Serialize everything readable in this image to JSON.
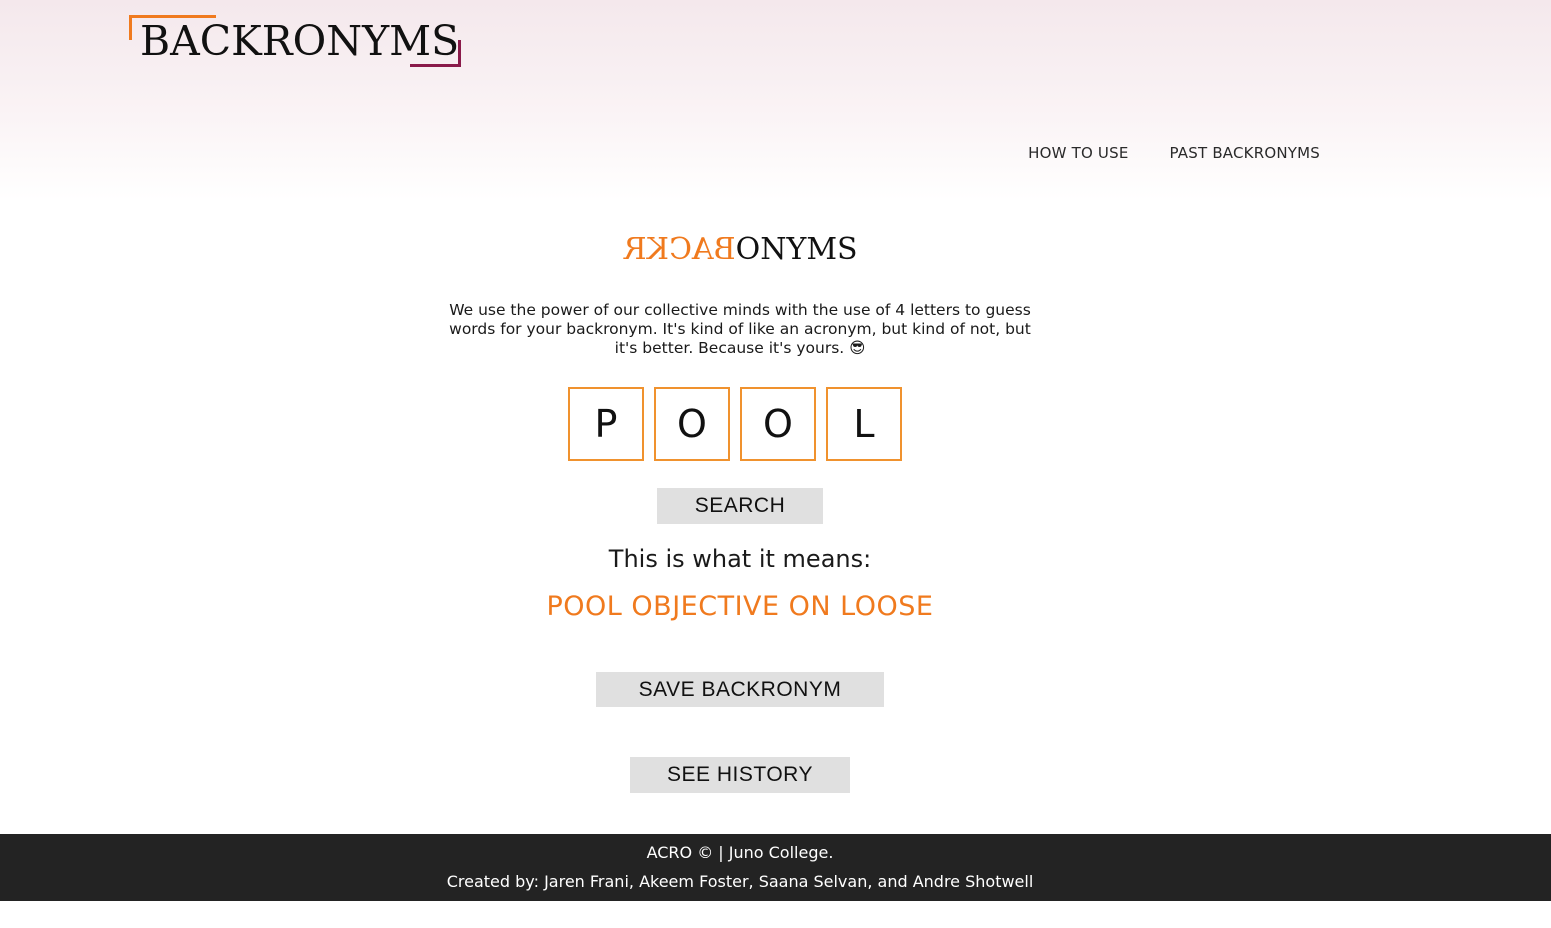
{
  "header": {
    "logo_text": "BACKRONYMS",
    "nav": [
      {
        "label": "HOW TO USE"
      },
      {
        "label": "PAST BACKRONYMS"
      }
    ]
  },
  "hero": {
    "logo_mirrored": "BACKR",
    "logo_rest": "ONYMS",
    "description": "We use the power of our collective minds with the use of 4 letters to guess words for your backronym. It's kind of like an acronym, but kind of not, but it's better. Because it's yours. 😎"
  },
  "letters": [
    "P",
    "O",
    "O",
    "L"
  ],
  "search_label": "SEARCH",
  "means_label": "This is what it means:",
  "result": "POOL OBJECTIVE ON LOOSE",
  "save_label": "SAVE BACKRONYM",
  "history_label": "SEE HISTORY",
  "footer": {
    "line1": "ACRO © | Juno College.",
    "line2": "Created by: Jaren Frani, Akeem Foster, Saana Selvan, and Andre Shotwell"
  },
  "colors": {
    "accent": "#f07a1e",
    "accent_secondary": "#8a1a4a",
    "footer_bg": "#232323",
    "button_bg": "#e0e0e0"
  }
}
